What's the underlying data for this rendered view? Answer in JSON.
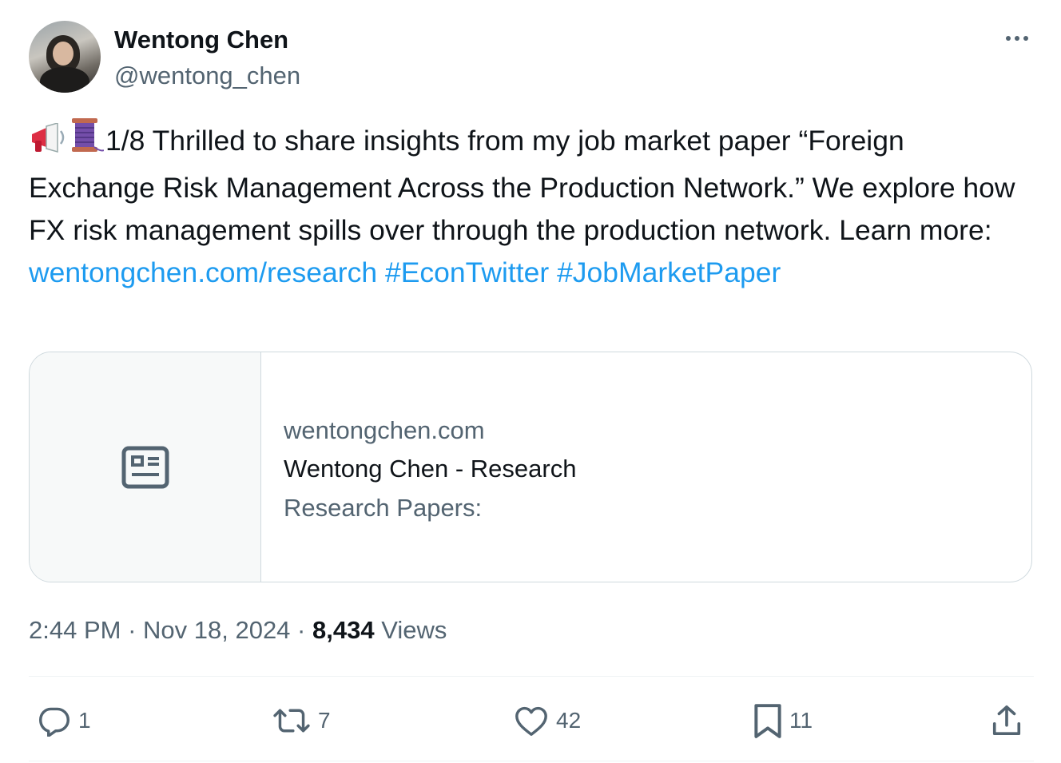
{
  "author": {
    "name": "Wentong Chen",
    "handle": "@wentong_chen"
  },
  "tweet": {
    "emojis": [
      "megaphone",
      "thread-spool"
    ],
    "text_part1": "1/8 Thrilled to share insights from my job market paper “Foreign Exchange Risk Management Across the Production Network.” We explore how FX risk management spills over through the production network. Learn more: ",
    "link_text": "wentongchen.com/research",
    "hashtag1": "#EconTwitter",
    "hashtag2": "#JobMarketPaper"
  },
  "card": {
    "icon": "article-icon",
    "domain": "wentongchen.com",
    "title": "Wentong Chen - Research",
    "description": "Research Papers:"
  },
  "meta": {
    "time": "2:44 PM",
    "separator": " · ",
    "date": "Nov 18, 2024",
    "views_count": "8,434",
    "views_label": "Views"
  },
  "actions": {
    "replies": "1",
    "reposts": "7",
    "likes": "42",
    "bookmarks": "11"
  },
  "colors": {
    "text": "#0f1419",
    "secondary": "#536471",
    "link": "#1d9bf0",
    "border": "#cfd9de"
  }
}
